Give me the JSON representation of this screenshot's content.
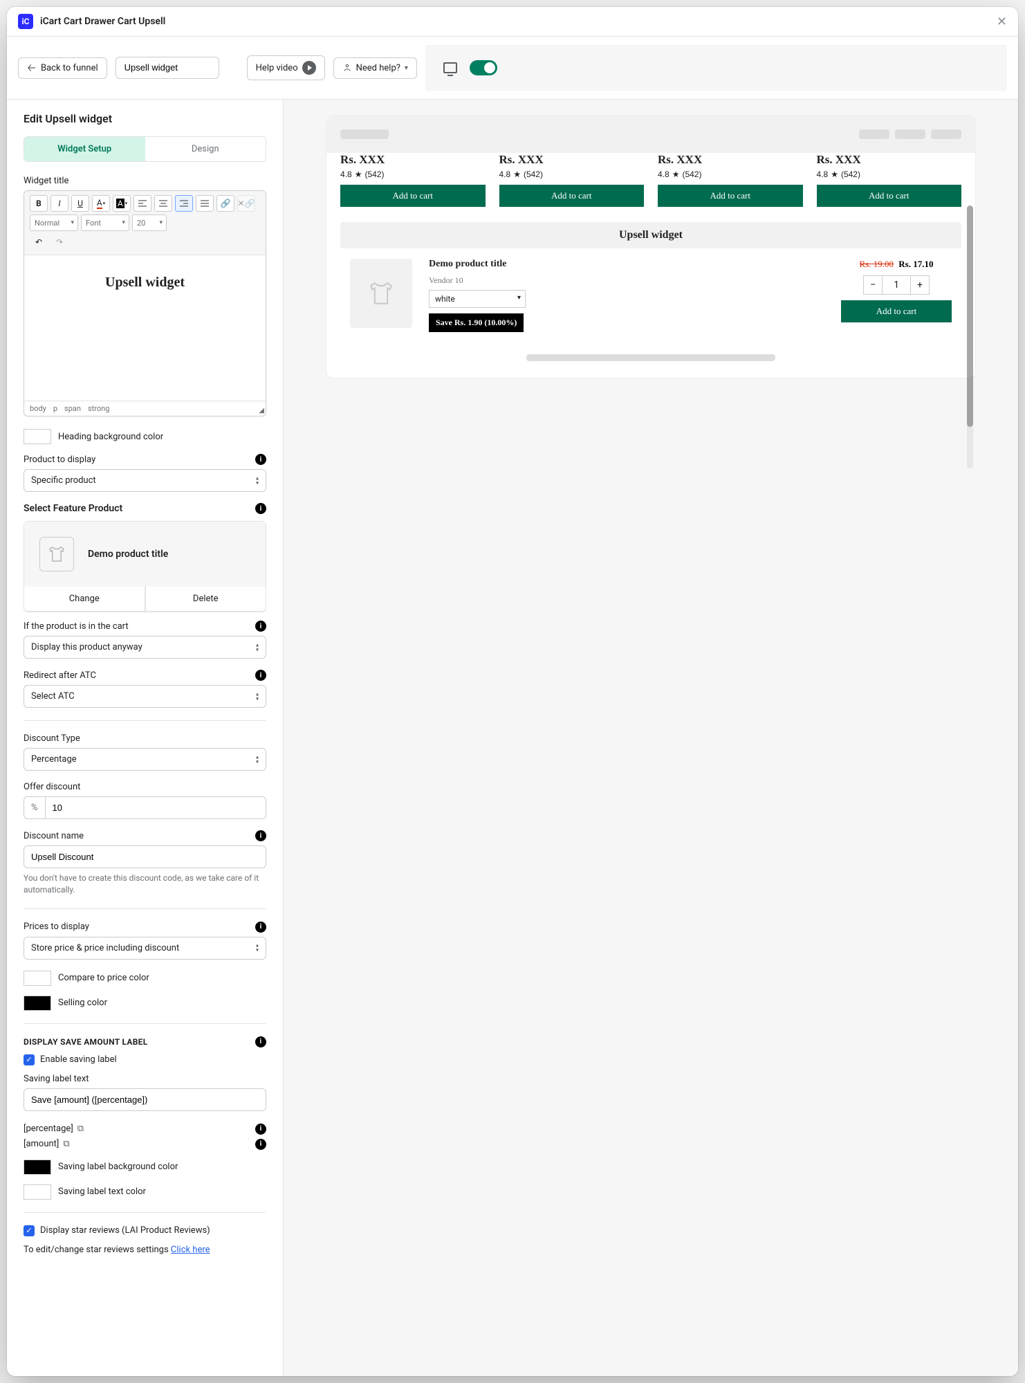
{
  "header": {
    "app_title": "iCart Cart Drawer Cart Upsell",
    "back": "Back to funnel",
    "widget_name_value": "Upsell widget",
    "help_video": "Help video",
    "need_help": "Need help?"
  },
  "panel": {
    "title": "Edit Upsell widget",
    "tabs": {
      "setup": "Widget Setup",
      "design": "Design"
    },
    "widget_title_label": "Widget title",
    "rte": {
      "normal": "Normal",
      "font": "Font",
      "size": "20",
      "content": "Upsell widget",
      "path": {
        "body": "body",
        "p": "p",
        "span": "span",
        "strong": "strong"
      }
    },
    "heading_bg_label": "Heading background color",
    "product_to_display_label": "Product to display",
    "product_to_display_value": "Specific product",
    "select_feature_label": "Select Feature Product",
    "demo_product": "Demo product title",
    "change": "Change",
    "delete": "Delete",
    "if_in_cart_label": "If the product is in the cart",
    "if_in_cart_value": "Display this product anyway",
    "redirect_label": "Redirect after ATC",
    "redirect_value": "Select ATC",
    "discount_type_label": "Discount Type",
    "discount_type_value": "Percentage",
    "offer_discount_label": "Offer discount",
    "offer_discount_prefix": "%",
    "offer_discount_value": "10",
    "discount_name_label": "Discount name",
    "discount_name_value": "Upsell Discount",
    "discount_helper": "You don't have to create this discount code, as we take care of it automatically.",
    "prices_label": "Prices to display",
    "prices_value": "Store price & price including discount",
    "compare_color": "#ff0000",
    "compare_label": "Compare to price color",
    "selling_color": "#000000",
    "selling_label": "Selling color",
    "save_heading": "DISPLAY SAVE AMOUNT LABEL",
    "enable_saving_label": "Enable saving label",
    "saving_text_label": "Saving label text",
    "saving_text_value": "Save [amount] ([percentage])",
    "placeholder_percentage": "[percentage]",
    "placeholder_amount": "[amount]",
    "saving_bg_label": "Saving label background color",
    "saving_text_color_label": "Saving label text color",
    "saving_bg_color": "#000000",
    "saving_text_color": "#ffffff",
    "display_stars_label": "Display star reviews (LAI Product Reviews)",
    "edit_stars_text": "To edit/change star reviews settings ",
    "click_here": "Click here"
  },
  "preview": {
    "cards": [
      {
        "price": "Rs. XXX",
        "rating": "4.8",
        "count": "(542)",
        "atc": "Add to cart"
      },
      {
        "price": "Rs. XXX",
        "rating": "4.8",
        "count": "(542)",
        "atc": "Add to cart"
      },
      {
        "price": "Rs. XXX",
        "rating": "4.8",
        "count": "(542)",
        "atc": "Add to cart"
      },
      {
        "price": "Rs. XXX",
        "rating": "4.8",
        "count": "(542)",
        "atc": "Add to cart"
      }
    ],
    "upsell": {
      "heading": "Upsell widget",
      "title": "Demo product title",
      "vendor": "Vendor 10",
      "variant": "white",
      "save": "Save Rs. 1.90 (10.00%)",
      "old_price": "Rs. 19.00",
      "new_price": "Rs. 17.10",
      "qty": "1",
      "atc": "Add to cart"
    }
  }
}
